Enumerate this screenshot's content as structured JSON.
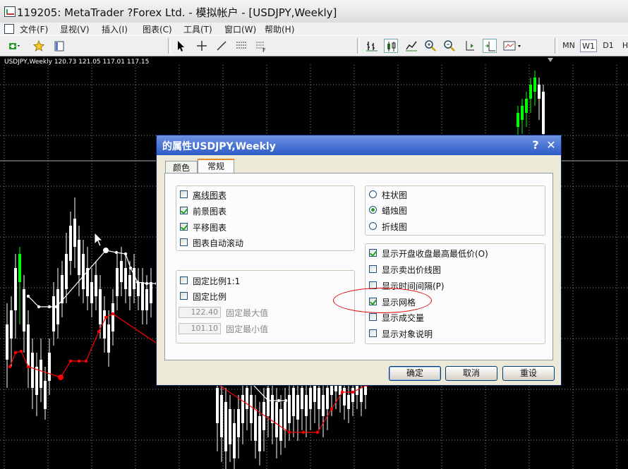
{
  "window": {
    "title": "119205: MetaTrader ?Forex Ltd. - 模拟帐户 - [USDJPY,Weekly]"
  },
  "menu": {
    "items": [
      "文件(F)",
      "显视(V)",
      "插入(I)",
      "图表(C)",
      "工具(T)",
      "窗口(W)",
      "帮助(H)"
    ]
  },
  "toolbar": {
    "timeframes": [
      "MN",
      "W1",
      "D1",
      "H"
    ],
    "active_timeframe": "W1"
  },
  "chart": {
    "label": "USDJPY,Weekly  120.73 121.05 117.01 117.15",
    "colors": {
      "background": "#000000",
      "bull": "#00ff00",
      "bear": "#ffffff",
      "line_white": "#ffffff",
      "line_red": "#ff0000"
    }
  },
  "dialog": {
    "title": "的属性USDJPY,Weekly",
    "help": "?",
    "close": "✕",
    "tabs": [
      {
        "label": "颜色",
        "active": false
      },
      {
        "label": "常规",
        "active": true
      }
    ],
    "left_checks": [
      {
        "label": "离线图表",
        "checked": false
      },
      {
        "label": "前景图表",
        "checked": true
      },
      {
        "label": "平移图表",
        "checked": true
      },
      {
        "label": "图表自动滚动",
        "checked": false
      }
    ],
    "scale_checks": [
      {
        "label": "固定比例1:1",
        "checked": false
      },
      {
        "label": "固定比例",
        "checked": false
      }
    ],
    "fixed_max": {
      "value": "122.40",
      "label": "固定最大值"
    },
    "fixed_min": {
      "value": "101.10",
      "label": "固定最小值"
    },
    "chart_types": [
      {
        "label": "柱状图",
        "checked": false
      },
      {
        "label": "蜡烛图",
        "checked": true
      },
      {
        "label": "折线图",
        "checked": false
      }
    ],
    "display_checks": [
      {
        "label": "显示开盘收盘最高最低价(O)",
        "checked": true
      },
      {
        "label": "显示卖出价线图",
        "checked": false
      },
      {
        "label": "显示时间间隔(P)",
        "checked": false
      },
      {
        "label": "显示网格",
        "checked": true
      },
      {
        "label": "显示成交量",
        "checked": false
      },
      {
        "label": "显示对象说明",
        "checked": false
      }
    ],
    "buttons": {
      "ok": "确定",
      "cancel": "取消",
      "reset": "重设"
    }
  }
}
